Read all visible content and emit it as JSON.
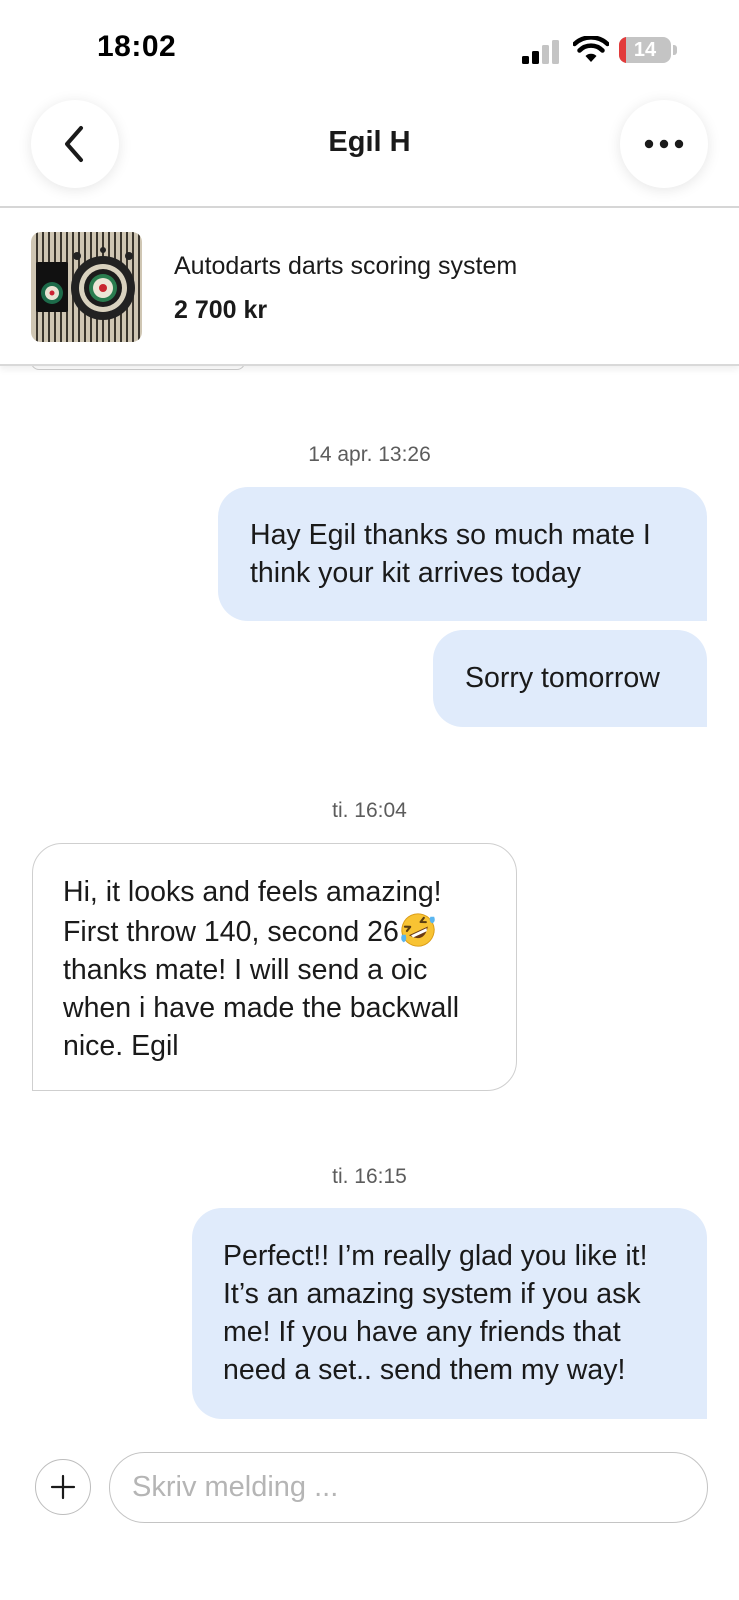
{
  "status_bar": {
    "time": "18:02",
    "battery_level": "14",
    "battery_fraction": 0.14,
    "icons": [
      "signal-icon",
      "wifi-icon",
      "battery-icon"
    ]
  },
  "header": {
    "title": "Egil H",
    "back_icon": "chevron-left-icon",
    "more_icon": "more-horizontal-icon"
  },
  "listing": {
    "title": "Autodarts darts scoring system",
    "price": "2 700 kr"
  },
  "conversation": {
    "groups": [
      {
        "timestamp": "14 apr. 13:26",
        "messages": [
          {
            "direction": "outgoing",
            "lines": [
              "Hay Egil thanks so much mate I",
              "think your kit arrives today"
            ]
          },
          {
            "direction": "outgoing",
            "lines": [
              "Sorry tomorrow"
            ]
          }
        ]
      },
      {
        "timestamp": "ti. 16:04",
        "messages": [
          {
            "direction": "incoming",
            "lines": [
              "Hi, it looks and feels amazing!",
              "First throw 140, second 26",
              "thanks mate! I will send a oic",
              "when i have made the backwall",
              "nice. Egil"
            ],
            "emoji": "rolling-on-floor-laughing"
          }
        ]
      },
      {
        "timestamp": "ti. 16:15",
        "messages": [
          {
            "direction": "outgoing",
            "lines": [
              "Perfect!! I’m really glad you like it!",
              "It’s an amazing system if you ask",
              "me! If you have any friends that",
              "need a set.. send them my way!"
            ]
          }
        ]
      }
    ]
  },
  "composer": {
    "placeholder": "Skriv melding ...",
    "value": "",
    "add_icon": "plus-icon"
  },
  "colors": {
    "outgoing_bubble": "#e0ebfb",
    "incoming_border": "#cfcfcf",
    "timestamp_text": "#5c5c5c",
    "battery_low": "#e23b3b"
  }
}
